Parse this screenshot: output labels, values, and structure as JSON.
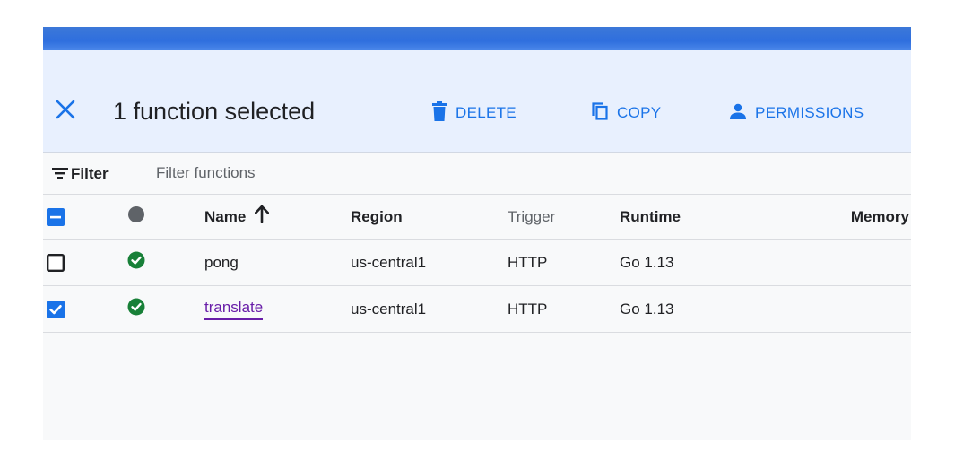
{
  "selection": {
    "title": "1 function selected"
  },
  "actions": {
    "delete_label": "DELETE",
    "copy_label": "COPY",
    "permissions_label": "PERMISSIONS"
  },
  "filter": {
    "label": "Filter",
    "placeholder": "Filter functions",
    "value": ""
  },
  "table": {
    "columns": {
      "name": "Name",
      "region": "Region",
      "trigger": "Trigger",
      "runtime": "Runtime",
      "memory": "Memory"
    },
    "sort": {
      "column": "name",
      "direction": "ascending"
    },
    "header_checkbox_state": "indeterminate",
    "rows": [
      {
        "name": "pong",
        "region": "us-central1",
        "trigger": "HTTP",
        "runtime": "Go 1.13",
        "memory": "",
        "status": "ok",
        "selected": false
      },
      {
        "name": "translate",
        "region": "us-central1",
        "trigger": "HTTP",
        "runtime": "Go 1.13",
        "memory": "",
        "status": "ok",
        "selected": true
      }
    ]
  },
  "colors": {
    "accent": "#1a73e8",
    "selection_bar": "#e8f0fe",
    "status_ok": "#188038",
    "status_header": "#5f6368",
    "link_visited": "#681da8"
  },
  "icons": {
    "close": "close-icon",
    "delete": "trash-icon",
    "copy": "copy-icon",
    "permissions": "person-icon",
    "filter": "filter-lines-icon",
    "sort": "arrow-up-icon",
    "status_ok": "check-circle-icon"
  }
}
